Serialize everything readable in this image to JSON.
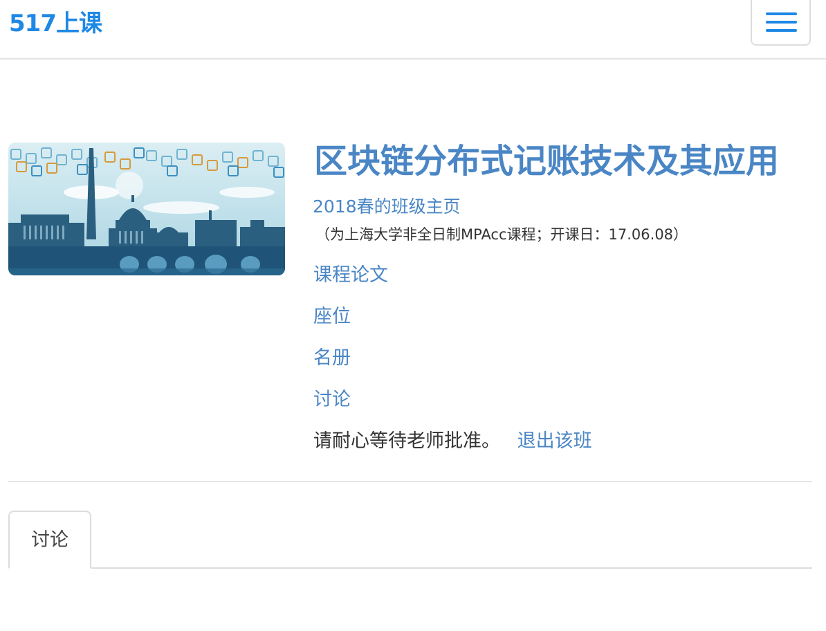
{
  "navbar": {
    "brand": "517上课",
    "menu_icon": "hamburger-menu-icon",
    "accent_color": "#1e88e5"
  },
  "course": {
    "title": "区块链分布式记账技术及其应用",
    "term_link": "2018春的班级主页",
    "note": "（为上海大学非全日制MPAcc课程；开课日：17.06.08）",
    "image": "city-skyline-banner"
  },
  "links": [
    {
      "label": "课程论文"
    },
    {
      "label": "座位"
    },
    {
      "label": "名册"
    },
    {
      "label": "讨论"
    }
  ],
  "status": {
    "text": "请耐心等待老师批准。",
    "quit_label": "退出该班"
  },
  "tabs": [
    {
      "label": "讨论",
      "active": true
    }
  ],
  "colors": {
    "link": "#4a86c5",
    "text": "#333333"
  }
}
